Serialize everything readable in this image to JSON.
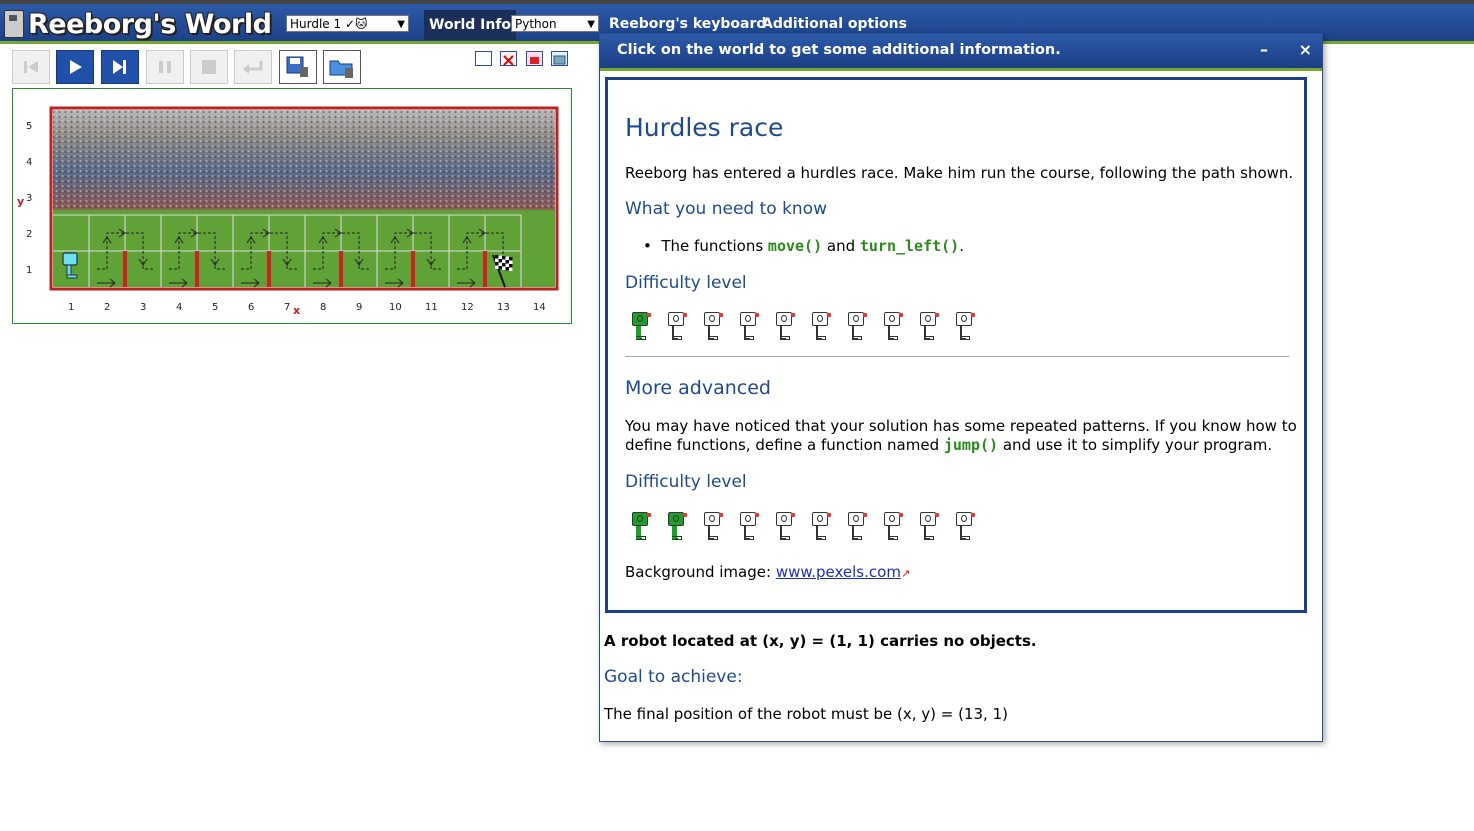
{
  "app": {
    "title": "Reeborg's World"
  },
  "top_menu": {
    "world_select": "Hurdle 1 ✓🐱",
    "world_info": "World Info",
    "language_select": "Python",
    "keyboard": "Reeborg's keyboard",
    "additional_options": "Additional options"
  },
  "controls": [
    "reverse-step",
    "run",
    "step",
    "pause",
    "stop",
    "reload",
    "save",
    "open"
  ],
  "world": {
    "y_label": "y",
    "x_label": "x",
    "y_ticks": [
      "1",
      "2",
      "3",
      "4",
      "5"
    ],
    "x_ticks": [
      "1",
      "2",
      "3",
      "4",
      "5",
      "6",
      "7",
      "8",
      "9",
      "10",
      "11",
      "12",
      "13",
      "14"
    ],
    "robot_position": [
      1,
      1
    ],
    "goal_position": [
      13,
      1
    ],
    "walls_at_x": [
      2,
      4,
      6,
      8,
      10,
      12
    ]
  },
  "info_window": {
    "header": "Click on the world to get some additional information.",
    "minimize": "–",
    "close": "×",
    "title": "Hurdles race",
    "intro": "Reeborg has entered a hurdles race. Make him run the course, following the path shown.",
    "need_heading": "What you need to know",
    "bullet_prefix": "The functions ",
    "fn_move": "move()",
    "bullet_and": " and ",
    "fn_turn_left": "turn_left()",
    "bullet_end": ".",
    "difficulty_heading": "Difficulty level",
    "difficulty_level": 1,
    "difficulty_max": 10,
    "advanced_heading": "More advanced",
    "advanced_text_1": "You may have noticed that your solution has some repeated patterns. If you know how to",
    "advanced_text_2a": "define functions, define a function named ",
    "fn_jump": "jump()",
    "advanced_text_2b": " and use it to simplify your program.",
    "difficulty_heading_2": "Difficulty level",
    "difficulty_level_2": 2,
    "background_label": "Background image: ",
    "background_link": "www.pexels.com",
    "robot_info": "A robot located at (x, y) = (1, 1) carries no objects.",
    "goal_heading": "Goal to achieve:",
    "goal_text": "The final position of the robot must be (x, y) = (13, 1)"
  }
}
